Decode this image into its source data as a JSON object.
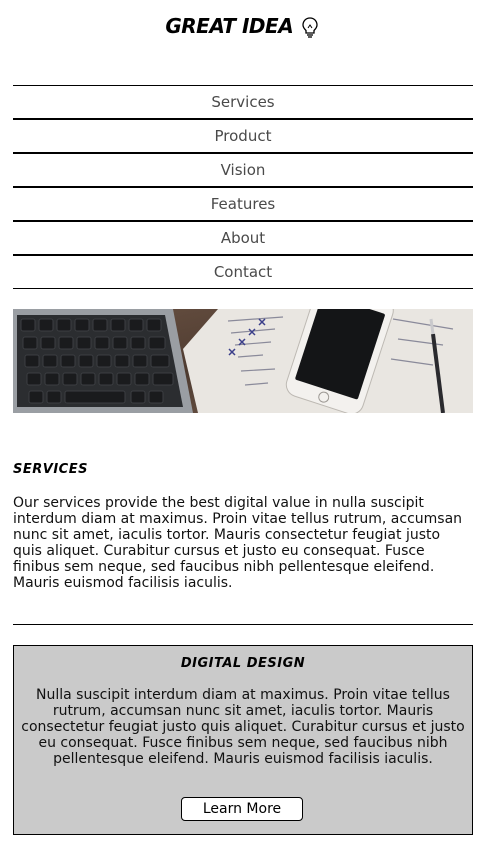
{
  "header": {
    "logo_text": "GREAT IDEA"
  },
  "nav": {
    "items": [
      {
        "label": "Services"
      },
      {
        "label": "Product"
      },
      {
        "label": "Vision"
      },
      {
        "label": "Features"
      },
      {
        "label": "About"
      },
      {
        "label": "Contact"
      }
    ]
  },
  "hero": {
    "icon": "desk-workspace-photo"
  },
  "services": {
    "title": "SERVICES",
    "text": "Our services provide the best digital value in nulla suscipit interdum diam at maximus. Proin vitae tellus rutrum, accumsan nunc sit amet, iaculis tortor. Mauris consectetur feugiat justo quis aliquet. Curabitur cursus et justo eu consequat. Fusce finibus sem neque, sed faucibus nibh pellentesque eleifend. Mauris euismod facilisis iaculis."
  },
  "card": {
    "title": "DIGITAL DESIGN",
    "text": "Nulla suscipit interdum diam at maximus. Proin vitae tellus rutrum, accumsan nunc sit amet, iaculis tortor. Mauris consectetur feugiat justo quis aliquet. Curabitur cursus et justo eu consequat. Fusce finibus sem neque, sed faucibus nibh pellentesque eleifend. Mauris euismod facilisis iaculis.",
    "button_label": "Learn More",
    "background": "#cacaca"
  }
}
